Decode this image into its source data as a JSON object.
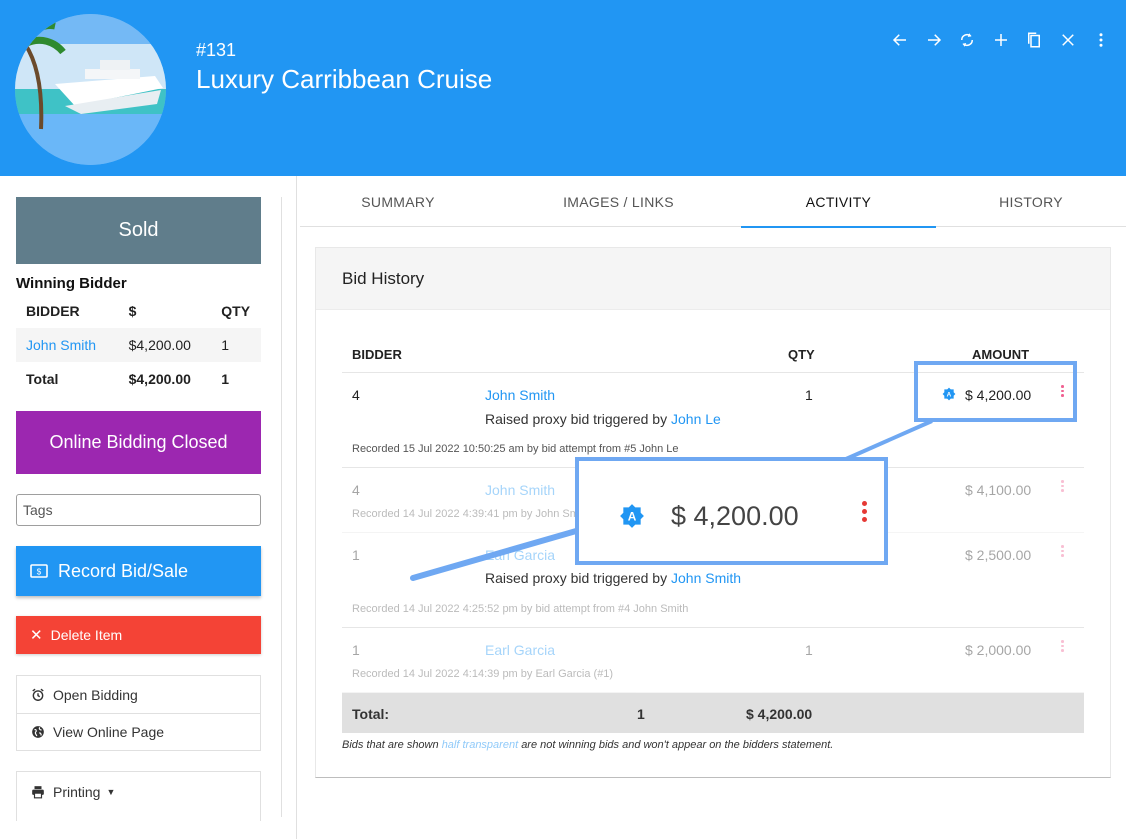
{
  "header": {
    "item_number": "#131",
    "title": "Luxury Carribbean Cruise",
    "toolbar": [
      "back-arrow-icon",
      "forward-arrow-icon",
      "refresh-icon",
      "add-icon",
      "copy-icon",
      "close-icon",
      "more-vert-icon"
    ],
    "color": "#2196f3"
  },
  "left": {
    "status": "Sold",
    "status_color": "#607d8b",
    "winning_label": "Winning Bidder",
    "winning_table": {
      "headers": [
        "BIDDER",
        "$",
        "QTY"
      ],
      "rows": [
        {
          "bidder": "John Smith",
          "amount": "$4,200.00",
          "qty": "1"
        }
      ],
      "total": {
        "label": "Total",
        "amount": "$4,200.00",
        "qty": "1"
      }
    },
    "bidding_status": "Online Bidding Closed",
    "bidding_status_color": "#9c27b0",
    "tags_placeholder": "Tags",
    "record_label": "Record Bid/Sale",
    "delete_label": "Delete Item",
    "actions": [
      {
        "label": "Open Bidding",
        "icon": "alarm-icon"
      },
      {
        "label": "View Online Page",
        "icon": "globe-icon"
      }
    ],
    "printing_label": "Printing"
  },
  "tabs": [
    {
      "label": "SUMMARY",
      "active": false
    },
    {
      "label": "IMAGES / LINKS",
      "active": false
    },
    {
      "label": "ACTIVITY",
      "active": true
    },
    {
      "label": "HISTORY",
      "active": false
    }
  ],
  "bid_history": {
    "title": "Bid History",
    "headers": {
      "bidder": "BIDDER",
      "qty": "QTY",
      "amount": "AMOUNT"
    },
    "rows": [
      {
        "number": "4",
        "name": "John Smith",
        "qty": "1",
        "amount": "$ 4,200.00",
        "proxy_prefix": "Raised proxy bid triggered by",
        "proxy_name": "John Le",
        "recorded": "Recorded 15 Jul 2022 10:50:25 am by bid attempt from #5 John Le",
        "winning": true
      },
      {
        "number": "4",
        "name": "John Smith",
        "qty": "",
        "amount": "$ 4,100.00",
        "recorded": "Recorded 14 Jul 2022 4:39:41 pm by John Smith",
        "winning": false
      },
      {
        "number": "1",
        "name": "Earl Garcia",
        "qty": "",
        "amount": "$ 2,500.00",
        "proxy_prefix": "Raised proxy bid triggered by",
        "proxy_name": "John Smith",
        "recorded": "Recorded 14 Jul 2022 4:25:52 pm by bid attempt from #4 John Smith",
        "winning": false
      },
      {
        "number": "1",
        "name": "Earl Garcia",
        "qty": "1",
        "amount": "$ 2,000.00",
        "recorded": "Recorded 14 Jul 2022 4:14:39 pm by Earl Garcia (#1)",
        "winning": false
      }
    ],
    "totals": {
      "label": "Total:",
      "qty": "1",
      "amount": "$ 4,200.00"
    },
    "footnote_pre": "Bids that are shown",
    "footnote_highlight": "half transparent",
    "footnote_post": "are not winning bids and won't appear on the bidders statement."
  },
  "callout": {
    "amount": "$ 4,200.00",
    "badge_icon": "auto-bid-badge-icon",
    "color": "#6fa8f2"
  }
}
